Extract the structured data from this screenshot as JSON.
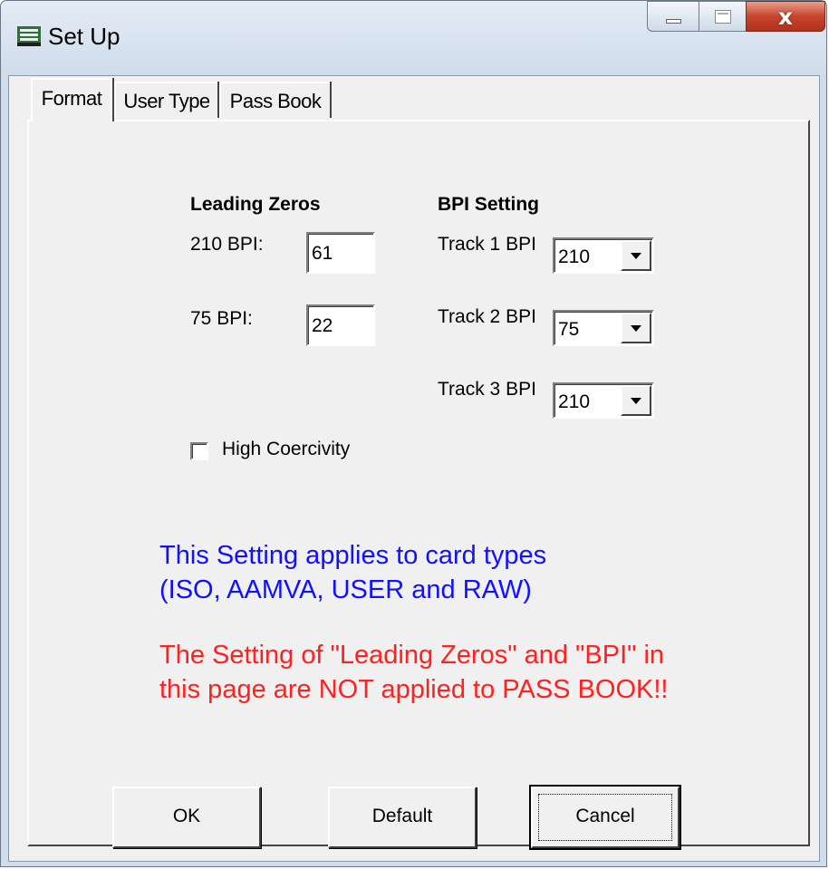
{
  "window": {
    "title": "Set Up",
    "icon": "setup-app-icon",
    "controls": {
      "minimize": "minimize-icon",
      "maximize": "maximize-icon",
      "close_glyph": "x"
    }
  },
  "tabs": [
    {
      "label": "Format",
      "active": true
    },
    {
      "label": "User Type",
      "active": false
    },
    {
      "label": "Pass Book",
      "active": false
    }
  ],
  "leading_zeros": {
    "heading": "Leading Zeros",
    "bpi210_label": "210 BPI:",
    "bpi210_value": "61",
    "bpi75_label": "75 BPI:",
    "bpi75_value": "22"
  },
  "bpi_setting": {
    "heading": "BPI Setting",
    "track1_label": "Track 1 BPI",
    "track1_value": "210",
    "track2_label": "Track 2 BPI",
    "track2_value": "75",
    "track3_label": "Track 3 BPI",
    "track3_value": "210"
  },
  "high_coercivity": {
    "label": "High Coercivity",
    "checked": false
  },
  "info": {
    "blue_line1": "This Setting applies to card types",
    "blue_line2": "(ISO, AAMVA, USER and RAW)",
    "red_line1": "The Setting of \"Leading Zeros\" and \"BPI\" in",
    "red_line2": "this page are NOT applied to PASS BOOK!!",
    "blue_color": "#1010ff",
    "red_color": "#ff2020"
  },
  "buttons": {
    "ok": "OK",
    "default": "Default",
    "cancel": "Cancel"
  }
}
